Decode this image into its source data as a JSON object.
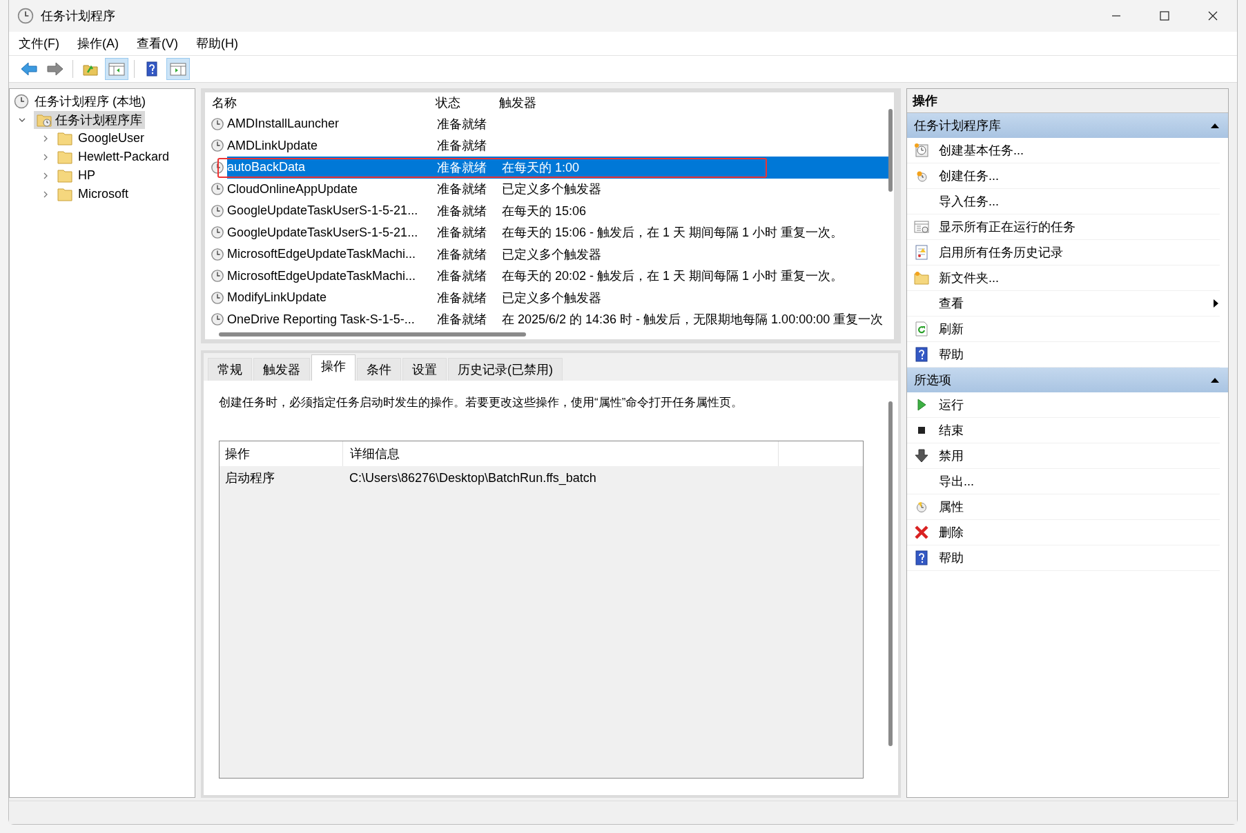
{
  "window": {
    "title": "任务计划程序"
  },
  "menu": [
    "文件(F)",
    "操作(A)",
    "查看(V)",
    "帮助(H)"
  ],
  "toolbar": [
    {
      "kind": "back",
      "pressed": false
    },
    {
      "kind": "forward",
      "pressed": false
    },
    {
      "kind": "folder-up",
      "pressed": false
    },
    {
      "kind": "tree-pane",
      "pressed": true
    },
    {
      "kind": "help",
      "pressed": false
    },
    {
      "kind": "action-pane",
      "pressed": true
    }
  ],
  "tree": {
    "label": "任务计划程序 (本地)",
    "children": [
      {
        "label": "任务计划程序库",
        "expanded": true,
        "selected": true,
        "children": [
          {
            "label": "GoogleUser",
            "expanded": false,
            "selected": false
          },
          {
            "label": "Hewlett-Packard",
            "expanded": false,
            "selected": false
          },
          {
            "label": "HP",
            "expanded": false,
            "selected": false
          },
          {
            "label": "Microsoft",
            "expanded": false,
            "selected": false
          }
        ]
      }
    ]
  },
  "task_list": {
    "columns": [
      "名称",
      "状态",
      "触发器"
    ],
    "rows": [
      {
        "name": "AMDInstallLauncher",
        "status": "准备就绪",
        "trigger": "",
        "selected": false,
        "annotated": false
      },
      {
        "name": "AMDLinkUpdate",
        "status": "准备就绪",
        "trigger": "",
        "selected": false,
        "annotated": false
      },
      {
        "name": "autoBackData",
        "status": "准备就绪",
        "trigger": "在每天的 1:00",
        "selected": true,
        "annotated": true
      },
      {
        "name": "CloudOnlineAppUpdate",
        "status": "准备就绪",
        "trigger": "已定义多个触发器",
        "selected": false,
        "annotated": false
      },
      {
        "name": "GoogleUpdateTaskUserS-1-5-21...",
        "status": "准备就绪",
        "trigger": "在每天的 15:06",
        "selected": false,
        "annotated": false
      },
      {
        "name": "GoogleUpdateTaskUserS-1-5-21...",
        "status": "准备就绪",
        "trigger": "在每天的 15:06 - 触发后，在 1 天 期间每隔 1 小时 重复一次。",
        "selected": false,
        "annotated": false
      },
      {
        "name": "MicrosoftEdgeUpdateTaskMachi...",
        "status": "准备就绪",
        "trigger": "已定义多个触发器",
        "selected": false,
        "annotated": false
      },
      {
        "name": "MicrosoftEdgeUpdateTaskMachi...",
        "status": "准备就绪",
        "trigger": "在每天的 20:02 - 触发后，在 1 天 期间每隔 1 小时 重复一次。",
        "selected": false,
        "annotated": false
      },
      {
        "name": "ModifyLinkUpdate",
        "status": "准备就绪",
        "trigger": "已定义多个触发器",
        "selected": false,
        "annotated": false
      },
      {
        "name": "OneDrive Reporting Task-S-1-5-...",
        "status": "准备就绪",
        "trigger": "在 2025/6/2 的 14:36 时 - 触发后，无限期地每隔 1.00:00:00 重复一次",
        "selected": false,
        "annotated": false
      }
    ]
  },
  "detail_tabs": [
    {
      "label": "常规",
      "selected": false
    },
    {
      "label": "触发器",
      "selected": false
    },
    {
      "label": "操作",
      "selected": true
    },
    {
      "label": "条件",
      "selected": false
    },
    {
      "label": "设置",
      "selected": false
    },
    {
      "label": "历史记录(已禁用)",
      "selected": false
    }
  ],
  "detail": {
    "description": "创建任务时，必须指定任务启动时发生的操作。若要更改这些操作，使用“属性”命令打开任务属性页。",
    "columns": [
      "操作",
      "详细信息"
    ],
    "rows": [
      {
        "action": "启动程序",
        "details": "C:\\Users\\86276\\Desktop\\BatchRun.ffs_batch"
      }
    ]
  },
  "actions_pane": {
    "title": "操作",
    "sections": [
      {
        "title": "任务计划程序库",
        "expanded": true,
        "items": [
          {
            "label": "创建基本任务...",
            "kind": "basic-task",
            "submenu": false
          },
          {
            "label": "创建任务...",
            "kind": "task",
            "submenu": false
          },
          {
            "label": "导入任务...",
            "kind": "none",
            "submenu": false
          },
          {
            "label": "显示所有正在运行的任务",
            "kind": "running",
            "submenu": false
          },
          {
            "label": "启用所有任务历史记录",
            "kind": "history",
            "submenu": false
          },
          {
            "label": "新文件夹...",
            "kind": "folder",
            "submenu": false
          },
          {
            "label": "查看",
            "kind": "none",
            "submenu": true
          },
          {
            "label": "刷新",
            "kind": "refresh",
            "submenu": false
          },
          {
            "label": "帮助",
            "kind": "help",
            "submenu": false
          }
        ]
      },
      {
        "title": "所选项",
        "expanded": true,
        "items": [
          {
            "label": "运行",
            "kind": "run",
            "submenu": false
          },
          {
            "label": "结束",
            "kind": "stop",
            "submenu": false
          },
          {
            "label": "禁用",
            "kind": "disable",
            "submenu": false
          },
          {
            "label": "导出...",
            "kind": "none",
            "submenu": false
          },
          {
            "label": "属性",
            "kind": "properties",
            "submenu": false
          },
          {
            "label": "删除",
            "kind": "delete",
            "submenu": false
          },
          {
            "label": "帮助",
            "kind": "help",
            "submenu": false
          }
        ]
      }
    ]
  }
}
